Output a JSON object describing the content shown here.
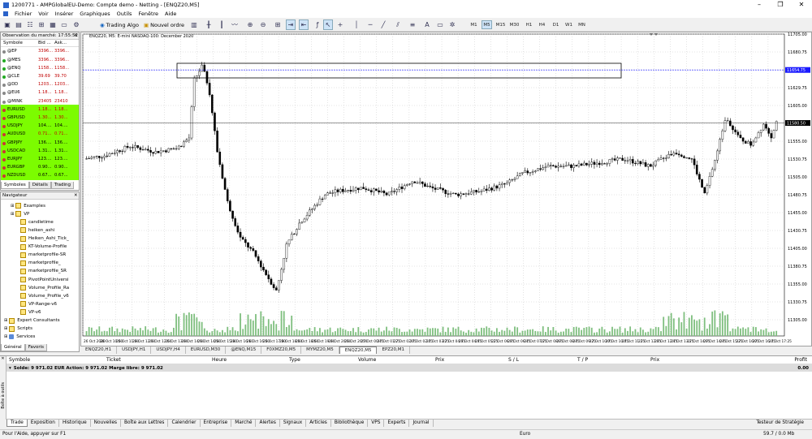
{
  "window": {
    "title": "1200771 - AMPGlobalEU-Demo: Compte demo - Netting - [ENQZ20,M5]"
  },
  "menu": [
    "Fichier",
    "Voir",
    "Insérer",
    "Graphiques",
    "Outils",
    "Fenêtre",
    "Aide"
  ],
  "toolbar": {
    "trading_algo": "Trading Algo",
    "new_order": "Nouvel ordre",
    "timeframes": [
      "M1",
      "M5",
      "M15",
      "M30",
      "H1",
      "H4",
      "D1",
      "W1",
      "MN"
    ],
    "active_timeframe": "M5"
  },
  "market_watch": {
    "title": "Observation du marché: 17:55:52",
    "columns": [
      "Symbole",
      "Bid ...",
      "Ask..."
    ],
    "rows": [
      {
        "symbol": "@EP",
        "bid": "3396...",
        "ask": "3396...",
        "bg": "#ffffff",
        "bidc": "#c00000",
        "askc": "#c00000",
        "icon": "#888"
      },
      {
        "symbol": "@MES",
        "bid": "3396...",
        "ask": "3396...",
        "bg": "#ffffff",
        "bidc": "#c00000",
        "askc": "#c00000",
        "icon": "#2a2"
      },
      {
        "symbol": "@ENQ",
        "bid": "1158...",
        "ask": "1158...",
        "bg": "#ffffff",
        "bidc": "#c00000",
        "askc": "#c00000",
        "icon": "#2a2"
      },
      {
        "symbol": "@CLE",
        "bid": "39.69",
        "ask": "39.70",
        "bg": "#ffffff",
        "bidc": "#c00000",
        "askc": "#c00000",
        "icon": "#2a2"
      },
      {
        "symbol": "@DD",
        "bid": "1203...",
        "ask": "1203...",
        "bg": "#ffffff",
        "bidc": "#c00000",
        "askc": "#c00000",
        "icon": "#888"
      },
      {
        "symbol": "@EU6",
        "bid": "1.18...",
        "ask": "1.18...",
        "bg": "#ffffff",
        "bidc": "#c00000",
        "askc": "#c00000",
        "icon": "#888"
      },
      {
        "symbol": "@MINK",
        "bid": "23405",
        "ask": "23410",
        "bg": "#ffffff",
        "bidc": "#c00000",
        "askc": "#c00000",
        "icon": "#888"
      },
      {
        "symbol": "EURUSD",
        "bid": "1.18...",
        "ask": "1.18...",
        "bg": "#7cfc00",
        "bidc": "#c00000",
        "askc": "#c00000",
        "icon": "#c33"
      },
      {
        "symbol": "GBPUSD",
        "bid": "1.30...",
        "ask": "1.30...",
        "bg": "#7cfc00",
        "bidc": "#c00000",
        "askc": "#c00000",
        "icon": "#c33"
      },
      {
        "symbol": "USDJPY",
        "bid": "104....",
        "ask": "104....",
        "bg": "#7cfc00",
        "bidc": "#000000",
        "askc": "#000000",
        "icon": "#c33"
      },
      {
        "symbol": "AUDUSD",
        "bid": "0.71...",
        "ask": "0.71...",
        "bg": "#7cfc00",
        "bidc": "#c00000",
        "askc": "#c00000",
        "icon": "#c33"
      },
      {
        "symbol": "GBPJPY",
        "bid": "136....",
        "ask": "136....",
        "bg": "#7cfc00",
        "bidc": "#000000",
        "askc": "#000000",
        "icon": "#c33"
      },
      {
        "symbol": "USDCAD",
        "bid": "1.31...",
        "ask": "1.31...",
        "bg": "#7cfc00",
        "bidc": "#000000",
        "askc": "#000000",
        "icon": "#c33"
      },
      {
        "symbol": "EURJPY",
        "bid": "123....",
        "ask": "123....",
        "bg": "#7cfc00",
        "bidc": "#000000",
        "askc": "#000000",
        "icon": "#c33"
      },
      {
        "symbol": "EURGBP",
        "bid": "0.90...",
        "ask": "0.90...",
        "bg": "#7cfc00",
        "bidc": "#000000",
        "askc": "#000000",
        "icon": "#c33"
      },
      {
        "symbol": "NZDUSD",
        "bid": "0.67...",
        "ask": "0.67...",
        "bg": "#7cfc00",
        "bidc": "#000000",
        "askc": "#000000",
        "icon": "#c33"
      }
    ],
    "tabs": [
      "Symboles",
      "Détails",
      "Trading"
    ]
  },
  "navigator": {
    "title": "Navigateur",
    "items": [
      "Examples",
      "VP",
      "candletime",
      "heiken_ashi",
      "Heiken_Ashi_Tick_",
      "KT-Volume-Profile",
      "marketprofile-SR",
      "marketprofile_",
      "marketprofile_SR",
      "PivotPointUniversi",
      "Volume_Profile_Ra",
      "Volume_Profile_v6",
      "VP-Range-v6",
      "VP-v6",
      "Expert Consultants",
      "Scripts",
      "Services"
    ],
    "tabs": [
      "Général",
      "Favoris"
    ]
  },
  "chart": {
    "header": "ENQZ20, M5: E-mini NASDAQ-100: December 2020",
    "price_labels": [
      "11705.00",
      "11680.75",
      "11654.75",
      "11629.75",
      "11605.00",
      "11580.75",
      "11555.00",
      "11530.75",
      "11505.00",
      "11480.75",
      "11455.00",
      "11430.75",
      "11405.00",
      "11380.75",
      "11355.00",
      "11330.75",
      "11305.00"
    ],
    "hline_label": "11654.75",
    "current_label": "11580.50",
    "time_labels": [
      "26 Oct 2020",
      "26 Oct 10:50",
      "26 Oct 11:30",
      "26 Oct 12:10",
      "26 Oct 12:50",
      "26 Oct 13:30",
      "26 Oct 14:10",
      "26 Oct 14:50",
      "26 Oct 15:30",
      "26 Oct 16:10",
      "26 Oct 16:50",
      "26 Oct 17:30",
      "26 Oct 18:10",
      "26 Oct 18:50",
      "26 Oct 19:30",
      "26 Oct 20:10",
      "26 Oct 20:50",
      "27 Oct 00:45",
      "27 Oct 01:25",
      "27 Oct 02:05",
      "27 Oct 02:45",
      "27 Oct 03:25",
      "27 Oct 04:05",
      "27 Oct 04:45",
      "27 Oct 05:25",
      "27 Oct 06:05",
      "27 Oct 06:45",
      "27 Oct 07:25",
      "27 Oct 08:05",
      "27 Oct 08:45",
      "27 Oct 09:25",
      "27 Oct 10:05",
      "27 Oct 10:45",
      "27 Oct 11:25",
      "27 Oct 12:05",
      "27 Oct 12:45",
      "27 Oct 13:25",
      "27 Oct 14:05",
      "27 Oct 14:45",
      "27 Oct 15:25",
      "27 Oct 16:05",
      "27 Oct 16:45",
      "27 Oct 17:25"
    ],
    "colors": {
      "bg": "#ffffff",
      "grid": "#c8c8c8",
      "candle": "#000000",
      "volume": "#7fbf7f",
      "hline": "#1a1aff"
    }
  },
  "chart_tabs": [
    "ENQZ20,H1",
    "USDJPY,H1",
    "USDJPY,H4",
    "EURUSD,M30",
    "@ENQ,M15",
    "F0XMZ20,M5",
    "MYMZ20,M5",
    "ENQZ20,M5",
    "EPZ20,M1"
  ],
  "active_chart_tab": "ENQZ20,M5",
  "trade_table": {
    "columns": [
      "Symbole",
      "Ticket",
      "Heure",
      "Type",
      "Volume",
      "Prix",
      "S / L",
      "T / P",
      "Prix",
      "Profit"
    ],
    "balance_line": "Solde: 9 971.02 EUR  Action: 9 971.02  Marge libre: 9 971.02",
    "profit": "0.00",
    "side_label": "Boîte à outils"
  },
  "bottom_tabs": [
    "Trade",
    "Exposition",
    "Historique",
    "Nouvelles",
    "Boîte aux Lettres",
    "Calendrier",
    "Entreprise",
    "Marché",
    "Alertes",
    "Signaux",
    "Articles",
    "Bibliothèque",
    "VPS",
    "Experts",
    "Journal"
  ],
  "bottom_right_tab": "Testeur de Stratégie",
  "status": {
    "help": "Pour l'Aide, appuyer sur F1",
    "currency": "Euro",
    "traffic": "59.7 / 0.0 Mb"
  }
}
